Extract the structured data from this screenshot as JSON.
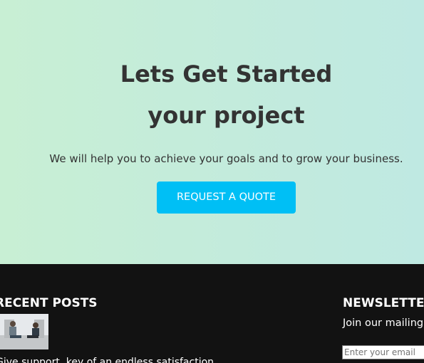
{
  "hero": {
    "title_line1": "Lets Get Started",
    "title_line2": "your project",
    "subtitle": "We will help you to achieve your goals and to grow your business.",
    "cta_label": "REQUEST A QUOTE"
  },
  "footer": {
    "recent_posts": {
      "heading": "RECENT POSTS",
      "items": [
        {
          "title": "Give support, key of an endless satisfaction"
        }
      ]
    },
    "newsletter": {
      "heading": "NEWSLETTER",
      "text": "Join our mailing list",
      "email_placeholder": "Enter your email"
    }
  },
  "colors": {
    "cta": "#00bff5",
    "footer_bg": "#121212",
    "hero_text": "#333333"
  }
}
